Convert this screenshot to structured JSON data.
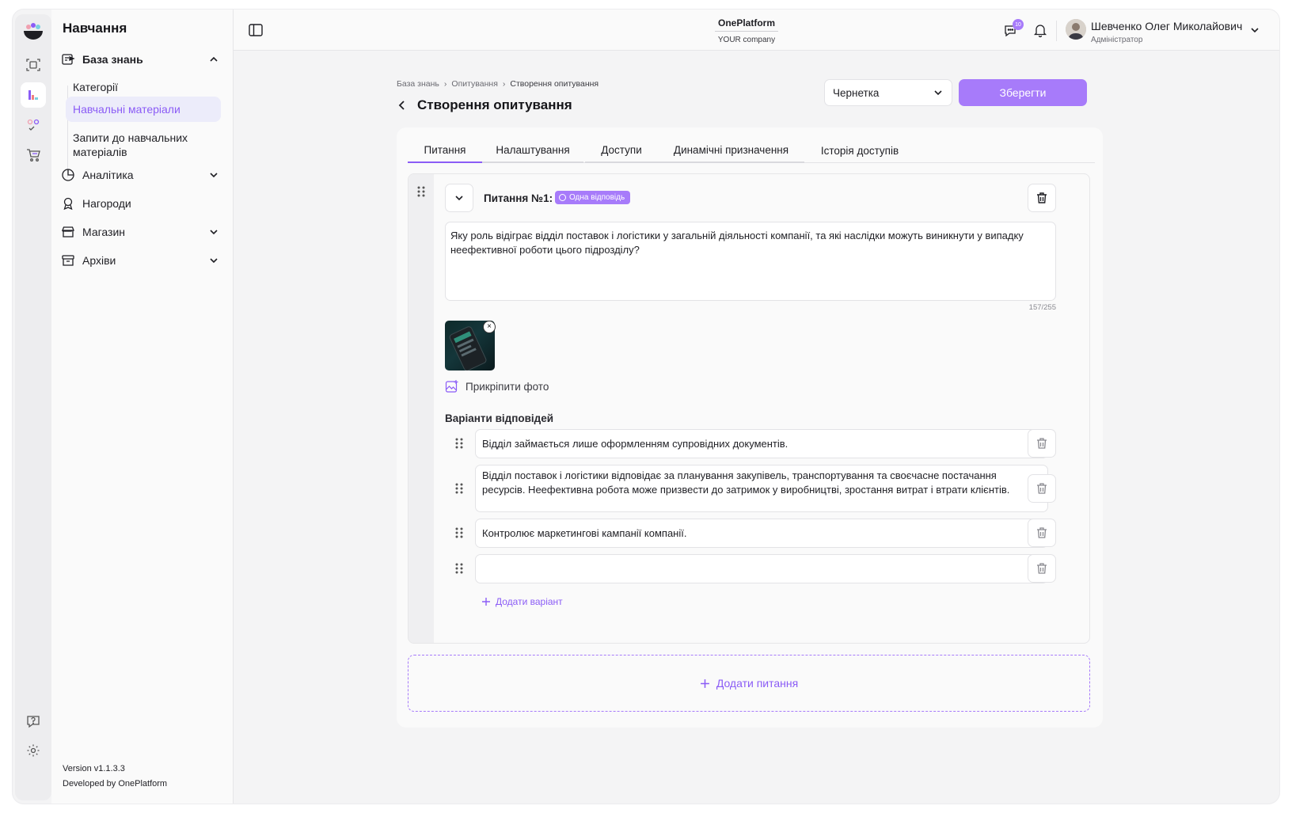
{
  "app": {
    "title": "Навчання"
  },
  "sidebar": {
    "title": "Навчання",
    "sections": [
      {
        "label": "База знань",
        "expanded": true
      },
      {
        "label": "Аналітика"
      },
      {
        "label": "Нагороди"
      },
      {
        "label": "Магазин"
      },
      {
        "label": "Архіви"
      }
    ],
    "subitems": [
      {
        "label": "Категорії"
      },
      {
        "label": "Навчальні матеріали",
        "active": true
      },
      {
        "label": "Запити до навчальних матеріалів"
      }
    ],
    "version": "Version v1.1.3.3",
    "developed_by": "Developed by OnePlatform"
  },
  "topbar": {
    "brand": "OnePlatform",
    "company": "YOUR company",
    "chat_badge": "10",
    "user_name": "Шевченко Олег Миколайович",
    "user_role": "Адміністратор"
  },
  "breadcrumbs": [
    "База знань",
    "Опитування",
    "Створення опитування"
  ],
  "page": {
    "title": "Створення опитування",
    "status": "Чернетка",
    "save_label": "Зберегти"
  },
  "tabs": [
    "Питання",
    "Налаштування",
    "Доступи",
    "Динамічні призначення",
    "Історія доступів"
  ],
  "question": {
    "title": "Питання №1:",
    "badge": "Одна відповідь",
    "text": "Яку роль відіграє відділ поставок і логістики у загальній діяльності компанії, та які наслідки можуть виникнути у випадку неефективної роботи цього підрозділу?",
    "counter": "157/255",
    "attach_label": "Прикріпити фото",
    "answers_title": "Варіанти відповідей",
    "answers": [
      "Відділ займається лише оформленням супровідних документів.",
      "Відділ поставок і логістики відповідає за планування закупівель, транспортування та своєчасне постачання ресурсів. Неефективна робота може призвести до затримок у виробництві, зростання витрат і втрати клієнтів.",
      "Контролює маркетингові кампанії компанії.",
      ""
    ],
    "add_variant_label": "Додати варіант"
  },
  "add_question_label": "Додати питання",
  "colors": {
    "accent": "#a77bfa",
    "accent_text": "#8b5cf6"
  }
}
